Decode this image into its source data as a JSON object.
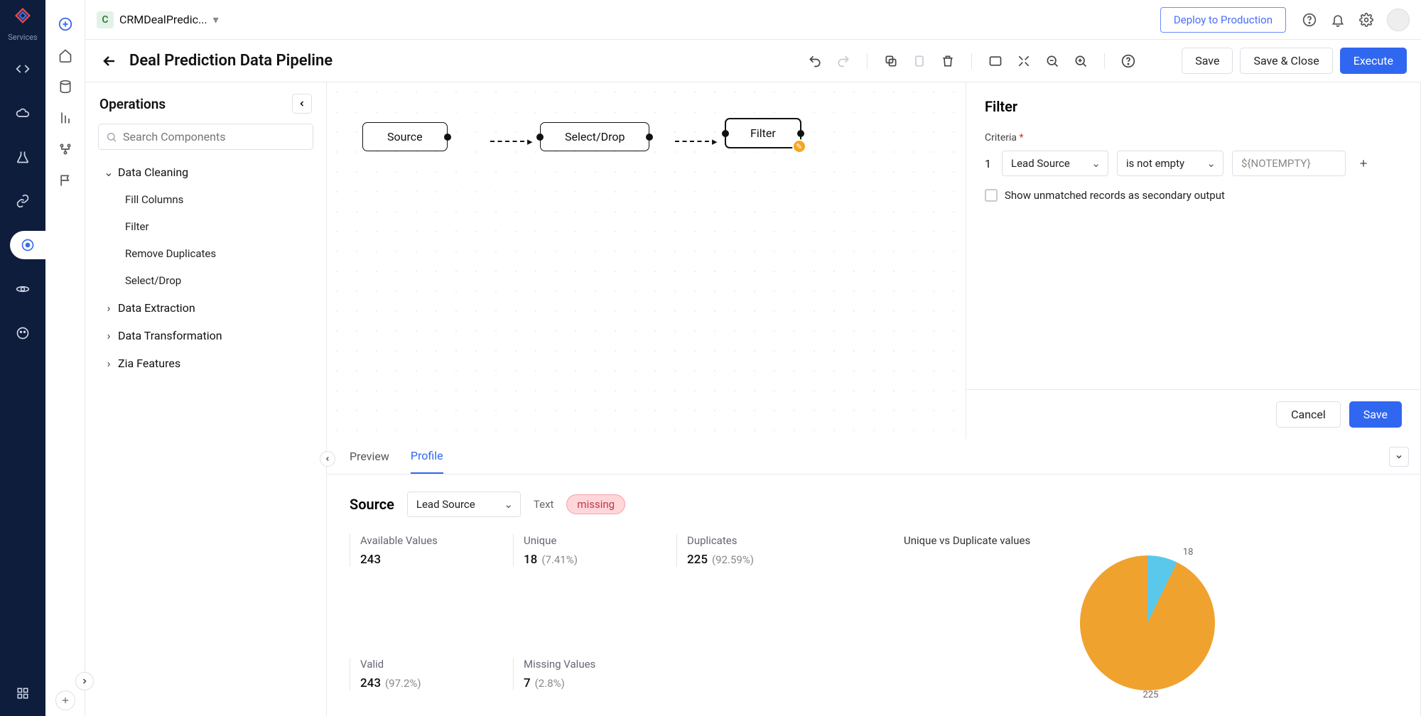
{
  "topbar": {
    "project_initial": "C",
    "project_name": "CRMDealPredic...",
    "deploy_label": "Deploy to Production"
  },
  "services_label": "Services",
  "toolbar": {
    "title": "Deal Prediction Data Pipeline",
    "save": "Save",
    "save_close": "Save & Close",
    "execute": "Execute"
  },
  "operations": {
    "title": "Operations",
    "search_placeholder": "Search Components",
    "groups": [
      {
        "label": "Data Cleaning",
        "expanded": true,
        "items": [
          "Fill Columns",
          "Filter",
          "Remove Duplicates",
          "Select/Drop"
        ]
      },
      {
        "label": "Data Extraction",
        "expanded": false
      },
      {
        "label": "Data Transformation",
        "expanded": false
      },
      {
        "label": "Zia Features",
        "expanded": false
      }
    ]
  },
  "canvas": {
    "nodes": [
      {
        "label": "Source"
      },
      {
        "label": "Select/Drop"
      },
      {
        "label": "Filter"
      }
    ]
  },
  "config": {
    "title": "Filter",
    "criteria_label": "Criteria",
    "row_idx": "1",
    "field": "Lead Source",
    "operator": "is not empty",
    "value_placeholder": "${NOTEMPTY}",
    "checkbox_label": "Show unmatched records as secondary output",
    "cancel": "Cancel",
    "save": "Save"
  },
  "tabs": {
    "preview": "Preview",
    "profile": "Profile"
  },
  "profile": {
    "source_label": "Source",
    "column": "Lead Source",
    "type_label": "Text",
    "badge": "missing",
    "stats": {
      "available": {
        "label": "Available Values",
        "val": "243"
      },
      "unique": {
        "label": "Unique",
        "val": "18",
        "pct": "(7.41%)"
      },
      "duplicates": {
        "label": "Duplicates",
        "val": "225",
        "pct": "(92.59%)"
      },
      "valid": {
        "label": "Valid",
        "val": "243",
        "pct": "(97.2%)"
      },
      "missing": {
        "label": "Missing Values",
        "val": "7",
        "pct": "(2.8%)"
      }
    }
  },
  "chart_data": {
    "type": "pie",
    "title": "Unique vs Duplicate values",
    "series": [
      {
        "name": "Unique",
        "value": 18,
        "color": "#5ac8ea"
      },
      {
        "name": "Duplicates",
        "value": 225,
        "color": "#f0a22f"
      }
    ]
  }
}
